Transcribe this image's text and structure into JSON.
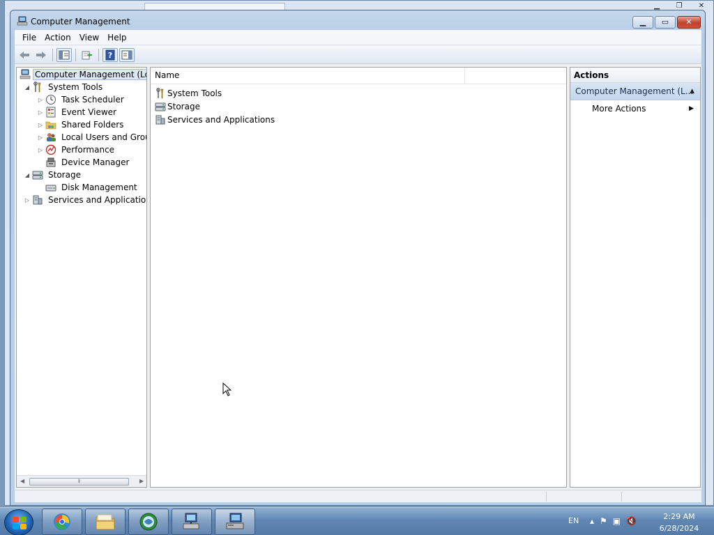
{
  "window": {
    "title": "Computer Management"
  },
  "menu": [
    "File",
    "Action",
    "View",
    "Help"
  ],
  "toolbar": {
    "buttons": [
      "back-arrow-icon",
      "forward-arrow-icon",
      "show-hide-tree-icon",
      "export-list-icon",
      "help-icon",
      "properties-pane-icon"
    ]
  },
  "tree": {
    "items": [
      {
        "label": "Computer Management (Local",
        "level": 0,
        "expander": "",
        "icon": "computer-management-icon",
        "selected": true
      },
      {
        "label": "System Tools",
        "level": 1,
        "expander": "expanded",
        "icon": "system-tools-icon"
      },
      {
        "label": "Task Scheduler",
        "level": 2,
        "expander": "collapsed",
        "icon": "task-scheduler-icon"
      },
      {
        "label": "Event Viewer",
        "level": 2,
        "expander": "collapsed",
        "icon": "event-viewer-icon"
      },
      {
        "label": "Shared Folders",
        "level": 2,
        "expander": "collapsed",
        "icon": "shared-folders-icon"
      },
      {
        "label": "Local Users and Groups",
        "level": 2,
        "expander": "collapsed",
        "icon": "local-users-icon"
      },
      {
        "label": "Performance",
        "level": 2,
        "expander": "collapsed",
        "icon": "performance-icon"
      },
      {
        "label": "Device Manager",
        "level": 2,
        "expander": "",
        "icon": "device-manager-icon"
      },
      {
        "label": "Storage",
        "level": 1,
        "expander": "expanded",
        "icon": "storage-icon"
      },
      {
        "label": "Disk Management",
        "level": 2,
        "expander": "",
        "icon": "disk-management-icon"
      },
      {
        "label": "Services and Applications",
        "level": 1,
        "expander": "collapsed",
        "icon": "services-apps-icon"
      }
    ]
  },
  "list": {
    "column_name": "Name",
    "rows": [
      {
        "label": "System Tools",
        "icon": "system-tools-icon"
      },
      {
        "label": "Storage",
        "icon": "storage-icon"
      },
      {
        "label": "Services and Applications",
        "icon": "services-apps-icon"
      }
    ]
  },
  "actions": {
    "header": "Actions",
    "section": "Computer Management (L...",
    "more": "More Actions"
  },
  "taskbar": {
    "apps": [
      "browser-icon",
      "file-explorer-icon",
      "network-globe-icon",
      "network-computer-icon",
      "computer-management-icon"
    ],
    "language": "EN",
    "time": "2:29 AM",
    "date": "6/28/2024"
  },
  "colors": {
    "accent": "#3a6ea5",
    "selection": "#dce8f6",
    "close_button": "#c0402c"
  }
}
